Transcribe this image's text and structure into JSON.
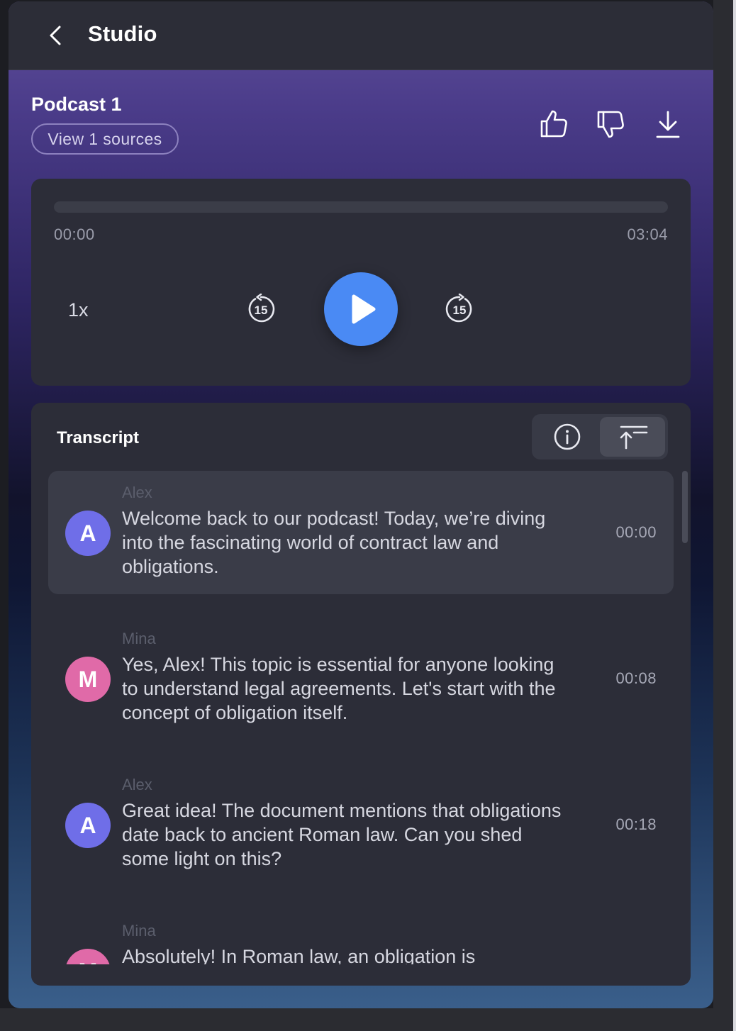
{
  "header": {
    "title": "Studio"
  },
  "podcast": {
    "title": "Podcast 1",
    "sources_label": "View 1 sources"
  },
  "player": {
    "current_time": "00:00",
    "duration": "03:04",
    "progress": 0,
    "speed": "1x",
    "skip_seconds": "15"
  },
  "transcript": {
    "heading": "Transcript",
    "entries": [
      {
        "speaker": "Alex",
        "initial": "A",
        "color": "#6f6ee8",
        "text": "Welcome back to our podcast! Today, we’re diving into the fascinating world of contract law and obligations.",
        "time": "00:00"
      },
      {
        "speaker": "Mina",
        "initial": "M",
        "color": "#e06aa8",
        "text": "Yes, Alex! This topic is essential for anyone looking to understand legal agreements. Let's start with the concept of obligation itself.",
        "time": "00:08"
      },
      {
        "speaker": "Alex",
        "initial": "A",
        "color": "#6f6ee8",
        "text": "Great idea! The document mentions that obligations date back to ancient Roman law. Can you shed some light on this?",
        "time": "00:18"
      },
      {
        "speaker": "Mina",
        "initial": "M",
        "color": "#e06aa8",
        "text": "Absolutely! In Roman law, an obligation is",
        "time": ""
      }
    ]
  },
  "colors": {
    "accent": "#4a8af4",
    "panel": "#2c2d38",
    "header": "#2c2d37"
  }
}
